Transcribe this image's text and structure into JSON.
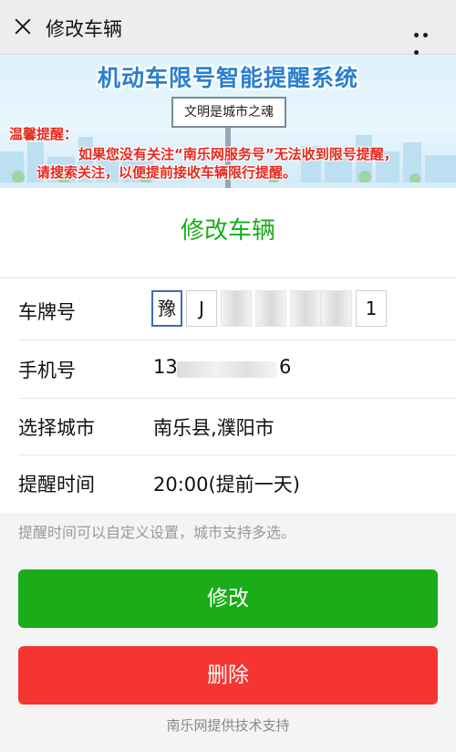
{
  "topbar": {
    "title": "修改车辆"
  },
  "banner": {
    "title": "机动车限号智能提醒系统",
    "sign_text": "文明是城市之魂",
    "warn_label": "温馨提醒：",
    "warn_line1": "如果您没有关注“南乐网服务号”无法收到限号提醒，",
    "warn_line2": "请搜索关注，以便提前接收车辆限行提醒。"
  },
  "heading": "修改车辆",
  "plate": {
    "label": "车牌号",
    "chars": [
      "豫",
      "J",
      "",
      "",
      "",
      "",
      "1"
    ]
  },
  "phone": {
    "label": "手机号",
    "prefix": "13",
    "suffix": "6"
  },
  "city": {
    "label": "选择城市",
    "value": "南乐县,濮阳市"
  },
  "remind": {
    "label": "提醒时间",
    "value": "20:00(提前一天)"
  },
  "hint": "提醒时间可以自定义设置，城市支持多选。",
  "buttons": {
    "edit": "修改",
    "delete": "删除"
  },
  "footer": "南乐网提供技术支持",
  "colors": {
    "primary_green": "#1aad19",
    "danger_red": "#f43530",
    "warning_red": "#e8281e",
    "banner_blue": "#2a7fd0"
  }
}
